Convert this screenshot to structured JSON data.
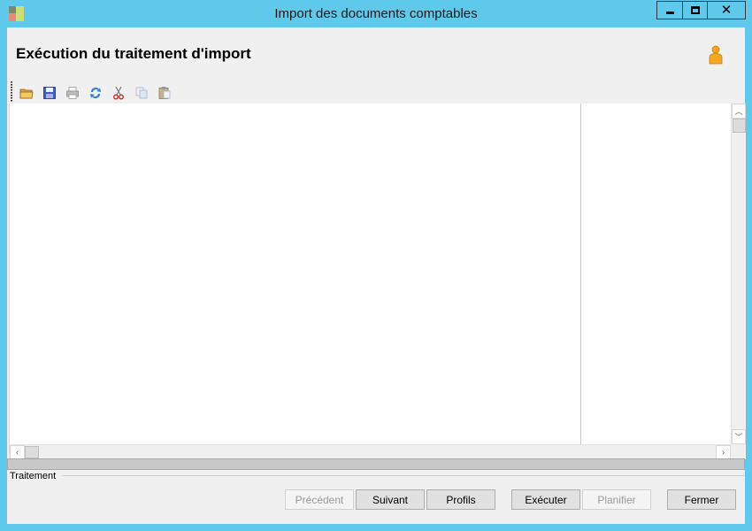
{
  "window": {
    "title": "Import des documents comptables",
    "app_icon": "app-icon",
    "controls": {
      "minimize": "minimize-icon",
      "maximize": "maximize-icon",
      "close": "close-icon"
    },
    "frame_color": "#5ec9ea"
  },
  "header": {
    "title": "Exécution du traitement d'import",
    "user_icon": "user-icon"
  },
  "toolbar": {
    "items": [
      {
        "name": "open-folder-icon",
        "enabled": true
      },
      {
        "name": "save-icon",
        "enabled": true
      },
      {
        "name": "print-icon",
        "enabled": false
      },
      {
        "name": "refresh-icon",
        "enabled": true
      },
      {
        "name": "cut-icon",
        "enabled": true
      },
      {
        "name": "copy-icon",
        "enabled": false
      },
      {
        "name": "paste-icon",
        "enabled": false
      }
    ]
  },
  "status": {
    "group_label": "Traitement"
  },
  "buttons": {
    "previous": "Précédent",
    "next": "Suivant",
    "profiles": "Profils",
    "execute": "Exécuter",
    "schedule": "Planifier",
    "close": "Fermer"
  }
}
